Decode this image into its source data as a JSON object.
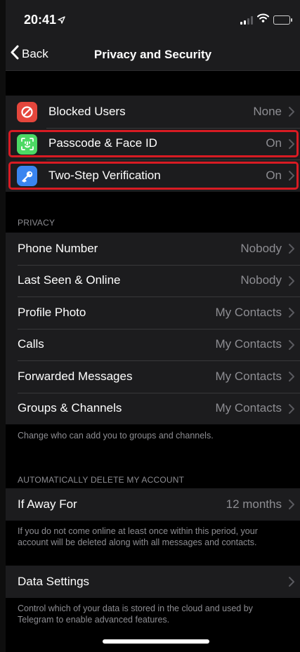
{
  "status_bar": {
    "time": "20:41"
  },
  "nav": {
    "back_label": "Back",
    "title": "Privacy and Security"
  },
  "security": {
    "items": [
      {
        "label": "Blocked Users",
        "value": "None",
        "icon": "blocked-icon",
        "icon_color": "#e5463c"
      },
      {
        "label": "Passcode & Face ID",
        "value": "On",
        "icon": "face-id-icon",
        "icon_color": "#4cd964",
        "highlighted": true
      },
      {
        "label": "Two-Step Verification",
        "value": "On",
        "icon": "key-icon",
        "icon_color": "#3a85f0",
        "highlighted": true
      }
    ]
  },
  "privacy": {
    "header": "PRIVACY",
    "items": [
      {
        "label": "Phone Number",
        "value": "Nobody"
      },
      {
        "label": "Last Seen & Online",
        "value": "Nobody"
      },
      {
        "label": "Profile Photo",
        "value": "My Contacts"
      },
      {
        "label": "Calls",
        "value": "My Contacts"
      },
      {
        "label": "Forwarded Messages",
        "value": "My Contacts"
      },
      {
        "label": "Groups & Channels",
        "value": "My Contacts"
      }
    ],
    "footer": "Change who can add you to groups and channels."
  },
  "auto_delete": {
    "header": "AUTOMATICALLY DELETE MY ACCOUNT",
    "item": {
      "label": "If Away For",
      "value": "12 months"
    },
    "footer": "If you do not come online at least once within this period, your account will be deleted along with all messages and contacts."
  },
  "data_settings": {
    "item": {
      "label": "Data Settings"
    },
    "footer": "Control which of your data is stored in the cloud and used by Telegram to enable advanced features."
  },
  "colors": {
    "highlight": "#d81b23",
    "secondary_text": "#8d8d92",
    "cell_background": "#1c1c1e"
  }
}
